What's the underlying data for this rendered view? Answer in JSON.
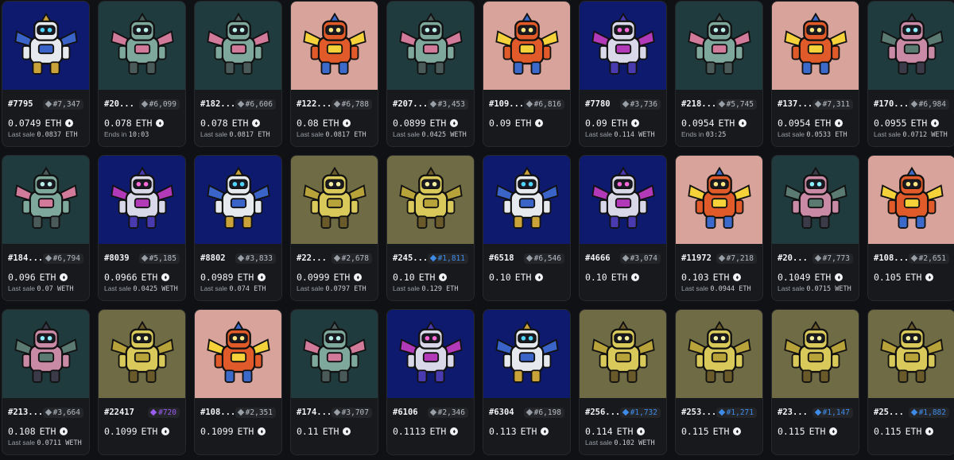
{
  "colors": {
    "navy": "#0d1a6e",
    "teal": "#1f3b3d",
    "pink": "#d8a39a",
    "olive": "#6f6b44",
    "rank_normal": "#9aa0a8",
    "rank_blue": "#3f8ce8",
    "rank_purple": "#9b5cf0"
  },
  "items": [
    {
      "token": "#7795",
      "rank": "#7,347",
      "rank_tier": "normal",
      "price": "0.0749",
      "currency": "ETH",
      "sub_label": "Last sale",
      "sub_value": "0.0837 ETH",
      "bg": "navy",
      "robot": "white"
    },
    {
      "token": "#20...",
      "rank": "#6,099",
      "rank_tier": "normal",
      "price": "0.078",
      "currency": "ETH",
      "sub_label": "Ends in",
      "sub_value": "10:03",
      "bg": "teal",
      "robot": "teal"
    },
    {
      "token": "#182...",
      "rank": "#6,606",
      "rank_tier": "normal",
      "price": "0.078",
      "currency": "ETH",
      "sub_label": "Last sale",
      "sub_value": "0.0817 ETH",
      "bg": "teal",
      "robot": "teal"
    },
    {
      "token": "#122...",
      "rank": "#6,788",
      "rank_tier": "normal",
      "price": "0.08",
      "currency": "ETH",
      "sub_label": "Last sale",
      "sub_value": "0.0817 ETH",
      "bg": "pink",
      "robot": "fire"
    },
    {
      "token": "#207...",
      "rank": "#3,453",
      "rank_tier": "normal",
      "price": "0.0899",
      "currency": "ETH",
      "sub_label": "Last sale",
      "sub_value": "0.0425 WETH",
      "bg": "teal",
      "robot": "teal"
    },
    {
      "token": "#109...",
      "rank": "#6,816",
      "rank_tier": "normal",
      "price": "0.09",
      "currency": "ETH",
      "sub_label": "",
      "sub_value": "",
      "bg": "pink",
      "robot": "fire"
    },
    {
      "token": "#7780",
      "rank": "#3,736",
      "rank_tier": "normal",
      "price": "0.09",
      "currency": "ETH",
      "sub_label": "Last sale",
      "sub_value": "0.114 WETH",
      "bg": "navy",
      "robot": "purple"
    },
    {
      "token": "#218...",
      "rank": "#5,745",
      "rank_tier": "normal",
      "price": "0.0954",
      "currency": "ETH",
      "sub_label": "Ends in",
      "sub_value": "03:25",
      "bg": "teal",
      "robot": "teal"
    },
    {
      "token": "#137...",
      "rank": "#7,311",
      "rank_tier": "normal",
      "price": "0.0954",
      "currency": "ETH",
      "sub_label": "Last sale",
      "sub_value": "0.0533 ETH",
      "bg": "pink",
      "robot": "fire"
    },
    {
      "token": "#170...",
      "rank": "#6,984",
      "rank_tier": "normal",
      "price": "0.0955",
      "currency": "ETH",
      "sub_label": "Last sale",
      "sub_value": "0.0712 WETH",
      "bg": "teal",
      "robot": "pinkbot"
    },
    {
      "token": "#184...",
      "rank": "#6,794",
      "rank_tier": "normal",
      "price": "0.096",
      "currency": "ETH",
      "sub_label": "Last sale",
      "sub_value": "0.07 WETH",
      "bg": "teal",
      "robot": "teal"
    },
    {
      "token": "#8039",
      "rank": "#5,185",
      "rank_tier": "normal",
      "price": "0.0966",
      "currency": "ETH",
      "sub_label": "Last sale",
      "sub_value": "0.0425 WETH",
      "bg": "navy",
      "robot": "purple"
    },
    {
      "token": "#8802",
      "rank": "#3,833",
      "rank_tier": "normal",
      "price": "0.0989",
      "currency": "ETH",
      "sub_label": "Last sale",
      "sub_value": "0.074 ETH",
      "bg": "navy",
      "robot": "white"
    },
    {
      "token": "#22...",
      "rank": "#2,678",
      "rank_tier": "normal",
      "price": "0.0999",
      "currency": "ETH",
      "sub_label": "Last sale",
      "sub_value": "0.0797 ETH",
      "bg": "olive",
      "robot": "gold"
    },
    {
      "token": "#245...",
      "rank": "#1,811",
      "rank_tier": "blue",
      "price": "0.10",
      "currency": "ETH",
      "sub_label": "Last sale",
      "sub_value": "0.129 ETH",
      "bg": "olive",
      "robot": "gold"
    },
    {
      "token": "#6518",
      "rank": "#6,546",
      "rank_tier": "normal",
      "price": "0.10",
      "currency": "ETH",
      "sub_label": "",
      "sub_value": "",
      "bg": "navy",
      "robot": "white"
    },
    {
      "token": "#4666",
      "rank": "#3,074",
      "rank_tier": "normal",
      "price": "0.10",
      "currency": "ETH",
      "sub_label": "",
      "sub_value": "",
      "bg": "navy",
      "robot": "purple"
    },
    {
      "token": "#11972",
      "rank": "#7,218",
      "rank_tier": "normal",
      "price": "0.103",
      "currency": "ETH",
      "sub_label": "Last sale",
      "sub_value": "0.0944 ETH",
      "bg": "pink",
      "robot": "fire"
    },
    {
      "token": "#20...",
      "rank": "#7,773",
      "rank_tier": "normal",
      "price": "0.1049",
      "currency": "ETH",
      "sub_label": "Last sale",
      "sub_value": "0.0715 WETH",
      "bg": "teal",
      "robot": "pinkbot"
    },
    {
      "token": "#108...",
      "rank": "#2,651",
      "rank_tier": "normal",
      "price": "0.105",
      "currency": "ETH",
      "sub_label": "",
      "sub_value": "",
      "bg": "pink",
      "robot": "fire"
    },
    {
      "token": "#213...",
      "rank": "#3,664",
      "rank_tier": "normal",
      "price": "0.108",
      "currency": "ETH",
      "sub_label": "Last sale",
      "sub_value": "0.0711 WETH",
      "bg": "teal",
      "robot": "pinkbot"
    },
    {
      "token": "#22417",
      "rank": "#720",
      "rank_tier": "purple",
      "price": "0.1099",
      "currency": "ETH",
      "sub_label": "",
      "sub_value": "",
      "bg": "olive",
      "robot": "gold"
    },
    {
      "token": "#108...",
      "rank": "#2,351",
      "rank_tier": "normal",
      "price": "0.1099",
      "currency": "ETH",
      "sub_label": "",
      "sub_value": "",
      "bg": "pink",
      "robot": "fire"
    },
    {
      "token": "#174...",
      "rank": "#3,707",
      "rank_tier": "normal",
      "price": "0.11",
      "currency": "ETH",
      "sub_label": "",
      "sub_value": "",
      "bg": "teal",
      "robot": "teal"
    },
    {
      "token": "#6106",
      "rank": "#2,346",
      "rank_tier": "normal",
      "price": "0.1113",
      "currency": "ETH",
      "sub_label": "",
      "sub_value": "",
      "bg": "navy",
      "robot": "purple"
    },
    {
      "token": "#6304",
      "rank": "#6,198",
      "rank_tier": "normal",
      "price": "0.113",
      "currency": "ETH",
      "sub_label": "",
      "sub_value": "",
      "bg": "navy",
      "robot": "white"
    },
    {
      "token": "#256...",
      "rank": "#1,732",
      "rank_tier": "blue",
      "price": "0.114",
      "currency": "ETH",
      "sub_label": "Last sale",
      "sub_value": "0.102 WETH",
      "bg": "olive",
      "robot": "gold"
    },
    {
      "token": "#253...",
      "rank": "#1,271",
      "rank_tier": "blue",
      "price": "0.115",
      "currency": "ETH",
      "sub_label": "",
      "sub_value": "",
      "bg": "olive",
      "robot": "gold"
    },
    {
      "token": "#23...",
      "rank": "#1,147",
      "rank_tier": "blue",
      "price": "0.115",
      "currency": "ETH",
      "sub_label": "",
      "sub_value": "",
      "bg": "olive",
      "robot": "gold"
    },
    {
      "token": "#25...",
      "rank": "#1,882",
      "rank_tier": "blue",
      "price": "0.115",
      "currency": "ETH",
      "sub_label": "",
      "sub_value": "",
      "bg": "olive",
      "robot": "gold"
    }
  ]
}
